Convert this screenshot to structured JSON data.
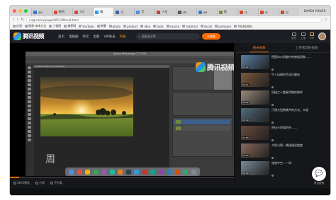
{
  "browser": {
    "tabs": [
      {
        "label": "we",
        "color": "#2f7bd6"
      },
      {
        "label": "數明",
        "color": "#e0443a"
      },
      {
        "label": "大S",
        "color": "#e0443a"
      },
      {
        "label": "腾",
        "color": "#2b9af3"
      },
      {
        "label": "(5",
        "color": "#3a5ea8"
      },
      {
        "label": "写",
        "color": "#4a90d9"
      },
      {
        "label": "人在",
        "color": "#c2433a"
      },
      {
        "label": "shr",
        "color": "#555555"
      },
      {
        "label": "we",
        "color": "#2f7bd6"
      },
      {
        "label": "图",
        "color": "#7a8b3a"
      },
      {
        "label": "ss",
        "color": "#d04a2a"
      },
      {
        "label": "ss",
        "color": "#d04a2a"
      },
      {
        "label": "ss",
        "color": "#d04a2a"
      }
    ],
    "active_tab_index": 3,
    "profile": "DAMEN POWER",
    "url": "v.qq.com/x/page/k05149fvaid.html",
    "bookmarks": [
      "应用",
      "网易·本地大全",
      "丁香园",
      "携养网",
      "YouTube",
      "快播",
      "photo",
      "product",
      "idea",
      "tools",
      "course",
      "material",
      "social",
      "pompare",
      "TRENDING"
    ]
  },
  "site": {
    "logo_text": "腾讯视频",
    "nav": [
      "首页",
      "电视剧",
      "综艺",
      "电影",
      "VIP会员",
      "科技"
    ],
    "nav_highlight_index": 5,
    "search_placeholder": "超星星学院",
    "search_button": "全网搜",
    "header_icons": [
      {
        "label": "历史",
        "name": "history-icon"
      },
      {
        "label": "上传",
        "name": "upload-icon"
      },
      {
        "label": "VIP",
        "name": "vip-icon"
      }
    ]
  },
  "player": {
    "ps_title": "Adobe Photoshop CC 2015",
    "doc_tab": "untitled-1@66.7% (RGB/8#)",
    "watermark": "腾讯视频",
    "caption_char": "周",
    "progress_fraction": 0.04,
    "controls": [
      "2805播放",
      "分享",
      "手机看"
    ]
  },
  "sidebar": {
    "tabs": [
      "相关视频",
      "上传者其他视频"
    ],
    "active_tab": 0,
    "items": [
      {
        "title": "德国冰川消融中的神秘现象……",
        "meta": "",
        "duration": "04:32",
        "color": "#5c7fa6"
      },
      {
        "title": "牛人自制的手动打磨机",
        "meta": "",
        "duration": "02:11",
        "color": "#7b5a3e"
      },
      {
        "title": "初级工人重复用物体制作",
        "meta": "",
        "duration": "03:05",
        "color": "#9a8a7a"
      },
      {
        "title": "只建大型刷铁件的方式，众极",
        "meta": "",
        "duration": "05:40",
        "color": "#4f6b7a"
      },
      {
        "title": "把玩卡的相机中……",
        "meta": "",
        "duration": "01:58",
        "color": "#6a4a3a"
      },
      {
        "title": "大陆与第一辑选建议超度",
        "meta": "",
        "duration": "03:22",
        "color": "#8a6a5a"
      },
      {
        "title": "旅游中空…一场",
        "meta": "",
        "duration": "02:40",
        "color": "#7a8a9a"
      }
    ],
    "float_button": "意见反馈"
  }
}
